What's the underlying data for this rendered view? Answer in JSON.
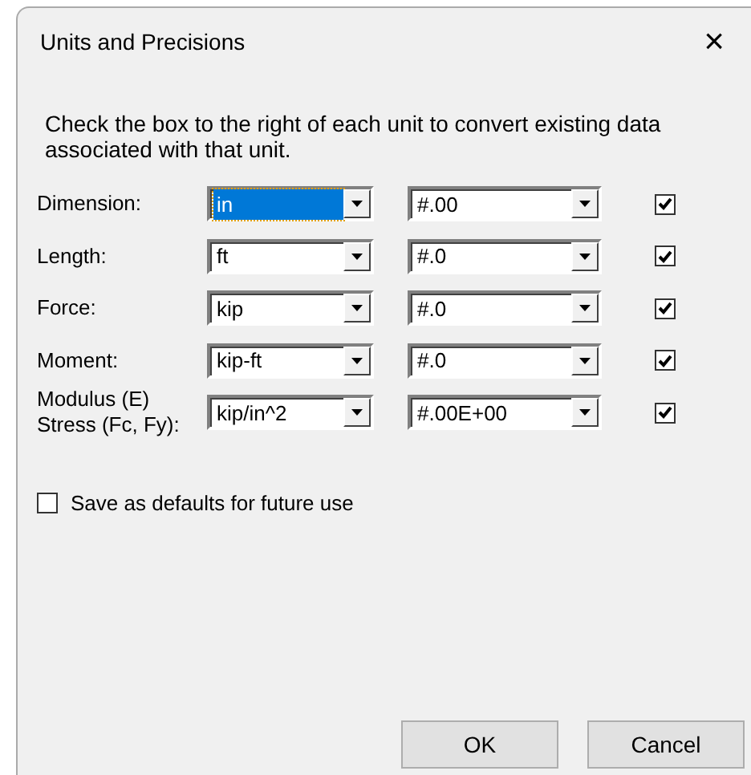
{
  "window": {
    "title": "Units and Precisions",
    "close": "×"
  },
  "instructions": "Check the box to the right of each unit to convert existing data associated with that unit.",
  "rows": [
    {
      "label": "Dimension:",
      "unit": "in",
      "unit_focused": true,
      "precision": "#.00",
      "convert": true
    },
    {
      "label": "Length:",
      "unit": "ft",
      "unit_focused": false,
      "precision": "#.0",
      "convert": true
    },
    {
      "label": "Force:",
      "unit": "kip",
      "unit_focused": false,
      "precision": "#.0",
      "convert": true
    },
    {
      "label": "Moment:",
      "unit": "kip-ft",
      "unit_focused": false,
      "precision": "#.0",
      "convert": true
    },
    {
      "label": "Modulus (E)\nStress (Fc, Fy):",
      "unit": "kip/in^2",
      "unit_focused": false,
      "precision": "#.00E+00",
      "convert": true
    }
  ],
  "save_defaults": {
    "label": "Save as defaults for future use",
    "checked": false
  },
  "buttons": [
    "OK",
    "Cancel"
  ]
}
